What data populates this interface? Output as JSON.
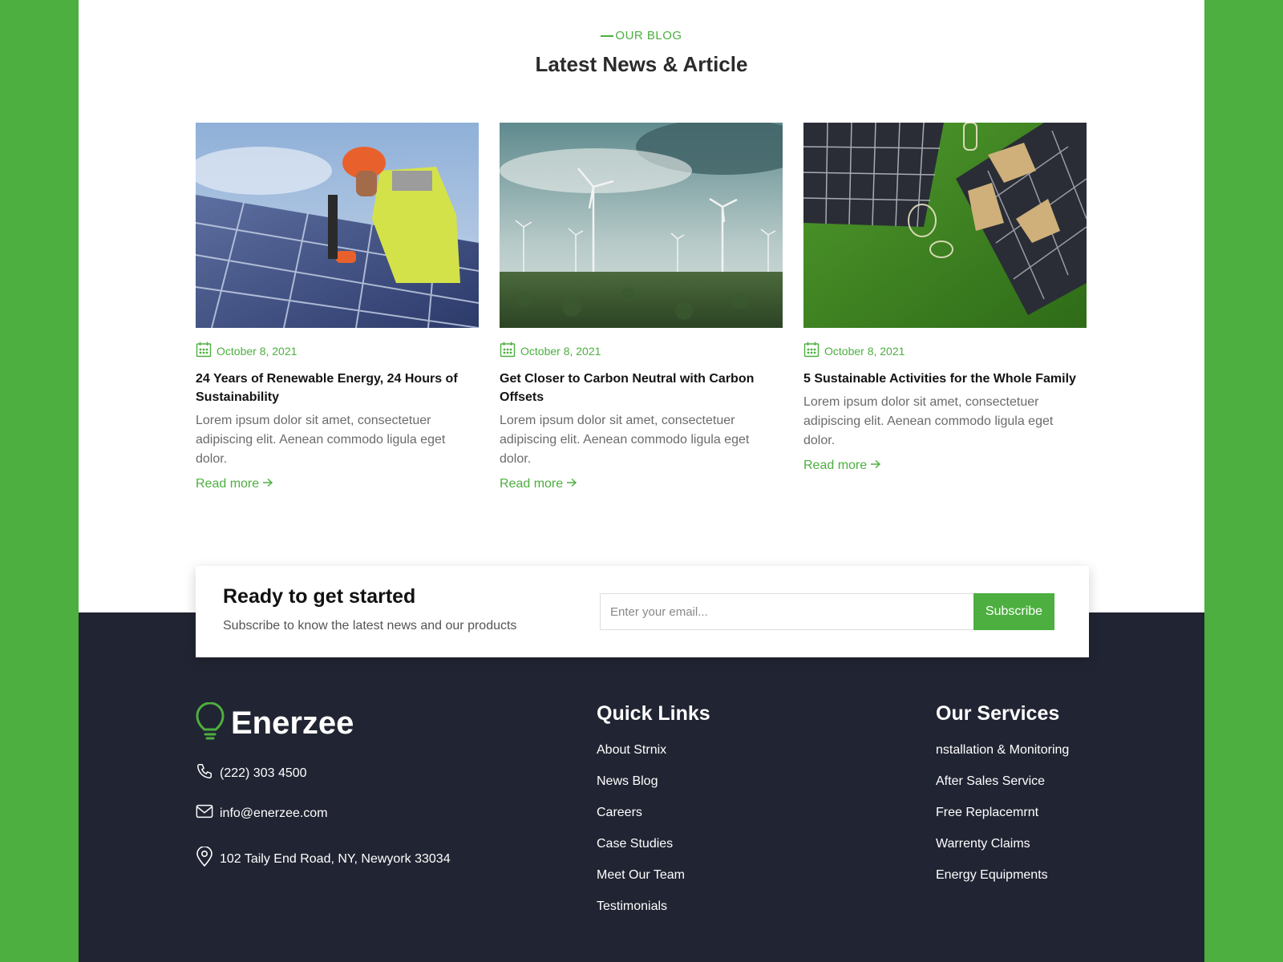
{
  "blog": {
    "eyebrow": "OUR BLOG",
    "title": "Latest News & Article",
    "posts": [
      {
        "image": "solar-worker-photo",
        "date": "October 8, 2021",
        "title": "24 Years of Renewable Energy, 24 Hours of Sustainability",
        "excerpt": "Lorem ipsum dolor sit amet, consectetuer adipiscing elit. Aenean commodo ligula eget dolor.",
        "read_more": "Read more"
      },
      {
        "image": "wind-turbines-photo",
        "date": "October 8, 2021",
        "title": "Get Closer to Carbon Neutral with Carbon Offsets",
        "excerpt": "Lorem ipsum dolor sit amet, consectetuer adipiscing elit. Aenean commodo ligula eget dolor.",
        "read_more": "Read more"
      },
      {
        "image": "solar-panels-recycle-photo",
        "date": "October 8, 2021",
        "title": "5 Sustainable Activities for the Whole Family",
        "excerpt": "Lorem ipsum dolor sit amet, consectetuer adipiscing elit. Aenean commodo ligula eget dolor.",
        "read_more": "Read more"
      }
    ]
  },
  "cta": {
    "title": "Ready to get started",
    "subtitle": "Subscribe to know the latest news and our products",
    "email_placeholder": "Enter your email...",
    "email_value": "",
    "button": "Subscribe"
  },
  "footer": {
    "brand": "Enerzee",
    "phone": "(222) 303 4500",
    "email": "info@enerzee.com",
    "address": "102 Taily End Road, NY, Newyork 33034",
    "quick_links": {
      "title": "Quick Links",
      "items": [
        "About Strnix",
        "News Blog",
        "Careers",
        "Case Studies",
        "Meet Our Team",
        "Testimonials"
      ]
    },
    "services": {
      "title": "Our Services",
      "items": [
        "nstallation & Monitoring",
        "After Sales Service",
        "Free Replacemrnt",
        "Warrenty Claims",
        "Energy Equipments"
      ]
    }
  },
  "colors": {
    "accent": "#4caf3f",
    "footer_bg": "#212432",
    "page_bg": "#ffffff"
  },
  "icons": [
    "calendar-icon",
    "arrow-right-icon",
    "lightbulb-logo-icon",
    "phone-icon",
    "mail-icon",
    "location-pin-icon"
  ]
}
